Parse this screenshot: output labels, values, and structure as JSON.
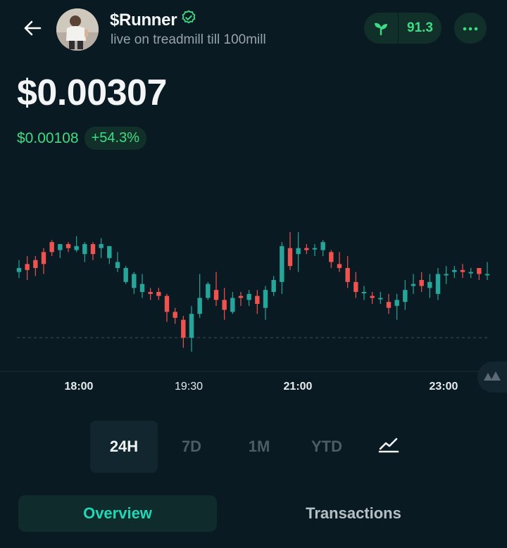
{
  "header": {
    "token_name": "$Runner",
    "token_subtitle": "live on treadmill till 100mill",
    "score": "91.3"
  },
  "price": {
    "value": "$0.00307",
    "change_abs": "$0.00108",
    "change_pct": "+54.3%"
  },
  "colors": {
    "up": "#26a69a",
    "down": "#ef5350",
    "accent": "#3ddc84",
    "tab_accent": "#21d7b7",
    "bg": "#0a1a23"
  },
  "ranges": [
    "24H",
    "7D",
    "1M",
    "YTD"
  ],
  "active_range": "24H",
  "tabs": {
    "overview": "Overview",
    "transactions": "Transactions"
  },
  "chart_data": {
    "type": "candlestick",
    "x_ticks": [
      "18:00",
      "19:30",
      "21:00",
      "23:00"
    ],
    "baseline_guide": "dashed",
    "candles": [
      {
        "o": 20,
        "c": 18,
        "h": 14,
        "l": 23
      },
      {
        "o": 16,
        "c": 19,
        "h": 12,
        "l": 24
      },
      {
        "o": 14,
        "c": 18,
        "h": 12,
        "l": 22
      },
      {
        "o": 10,
        "c": 16,
        "h": 8,
        "l": 21
      },
      {
        "o": 5,
        "c": 10,
        "h": 4,
        "l": 12
      },
      {
        "o": 9,
        "c": 6,
        "h": 6,
        "l": 13
      },
      {
        "o": 6,
        "c": 8,
        "h": 5,
        "l": 10
      },
      {
        "o": 9,
        "c": 7,
        "h": 2,
        "l": 10
      },
      {
        "o": 11,
        "c": 6,
        "h": 5,
        "l": 15
      },
      {
        "o": 6,
        "c": 11,
        "h": 5,
        "l": 14
      },
      {
        "o": 8,
        "c": 6,
        "h": 3,
        "l": 13
      },
      {
        "o": 13,
        "c": 7,
        "h": 7,
        "l": 16
      },
      {
        "o": 18,
        "c": 15,
        "h": 10,
        "l": 20
      },
      {
        "o": 25,
        "c": 18,
        "h": 17,
        "l": 26
      },
      {
        "o": 28,
        "c": 21,
        "h": 20,
        "l": 31
      },
      {
        "o": 30,
        "c": 26,
        "h": 21,
        "l": 33
      },
      {
        "o": 30,
        "c": 31,
        "h": 28,
        "l": 34
      },
      {
        "o": 30,
        "c": 32,
        "h": 28,
        "l": 34
      },
      {
        "o": 32,
        "c": 40,
        "h": 31,
        "l": 45
      },
      {
        "o": 40,
        "c": 43,
        "h": 38,
        "l": 46
      },
      {
        "o": 44,
        "c": 53,
        "h": 42,
        "l": 58
      },
      {
        "o": 53,
        "c": 41,
        "h": 37,
        "l": 60
      },
      {
        "o": 41,
        "c": 33,
        "h": 21,
        "l": 43
      },
      {
        "o": 33,
        "c": 26,
        "h": 25,
        "l": 34
      },
      {
        "o": 29,
        "c": 34,
        "h": 20,
        "l": 37
      },
      {
        "o": 34,
        "c": 39,
        "h": 28,
        "l": 44
      },
      {
        "o": 40,
        "c": 33,
        "h": 30,
        "l": 41
      },
      {
        "o": 32,
        "c": 33,
        "h": 30,
        "l": 37
      },
      {
        "o": 34,
        "c": 31,
        "h": 29,
        "l": 37
      },
      {
        "o": 32,
        "c": 36,
        "h": 29,
        "l": 41
      },
      {
        "o": 38,
        "c": 29,
        "h": 27,
        "l": 44
      },
      {
        "o": 30,
        "c": 24,
        "h": 22,
        "l": 32
      },
      {
        "o": 25,
        "c": 7,
        "h": 5,
        "l": 31
      },
      {
        "o": 8,
        "c": 17,
        "h": 0,
        "l": 19
      },
      {
        "o": 11,
        "c": 8,
        "h": 0,
        "l": 20
      },
      {
        "o": 8,
        "c": 9,
        "h": 6,
        "l": 11
      },
      {
        "o": 8,
        "c": 8,
        "h": 6,
        "l": 12
      },
      {
        "o": 9,
        "c": 5,
        "h": 4,
        "l": 12
      },
      {
        "o": 10,
        "c": 15,
        "h": 9,
        "l": 18
      },
      {
        "o": 16,
        "c": 18,
        "h": 10,
        "l": 20
      },
      {
        "o": 18,
        "c": 25,
        "h": 12,
        "l": 28
      },
      {
        "o": 25,
        "c": 30,
        "h": 20,
        "l": 33
      },
      {
        "o": 30,
        "c": 30,
        "h": 27,
        "l": 34
      },
      {
        "o": 32,
        "c": 33,
        "h": 30,
        "l": 36
      },
      {
        "o": 33,
        "c": 33,
        "h": 30,
        "l": 36
      },
      {
        "o": 35,
        "c": 38,
        "h": 31,
        "l": 41
      },
      {
        "o": 37,
        "c": 34,
        "h": 31,
        "l": 44
      },
      {
        "o": 35,
        "c": 29,
        "h": 24,
        "l": 39
      },
      {
        "o": 27,
        "c": 26,
        "h": 21,
        "l": 31
      },
      {
        "o": 24,
        "c": 27,
        "h": 20,
        "l": 30
      },
      {
        "o": 28,
        "c": 25,
        "h": 21,
        "l": 33
      },
      {
        "o": 31,
        "c": 21,
        "h": 18,
        "l": 34
      },
      {
        "o": 21,
        "c": 21,
        "h": 17,
        "l": 26
      },
      {
        "o": 20,
        "c": 19,
        "h": 17,
        "l": 23
      },
      {
        "o": 19,
        "c": 20,
        "h": 16,
        "l": 23
      },
      {
        "o": 20,
        "c": 20,
        "h": 18,
        "l": 23
      },
      {
        "o": 18,
        "c": 21,
        "h": 18,
        "l": 24
      },
      {
        "o": 21,
        "c": 21,
        "h": 15,
        "l": 24
      }
    ]
  }
}
